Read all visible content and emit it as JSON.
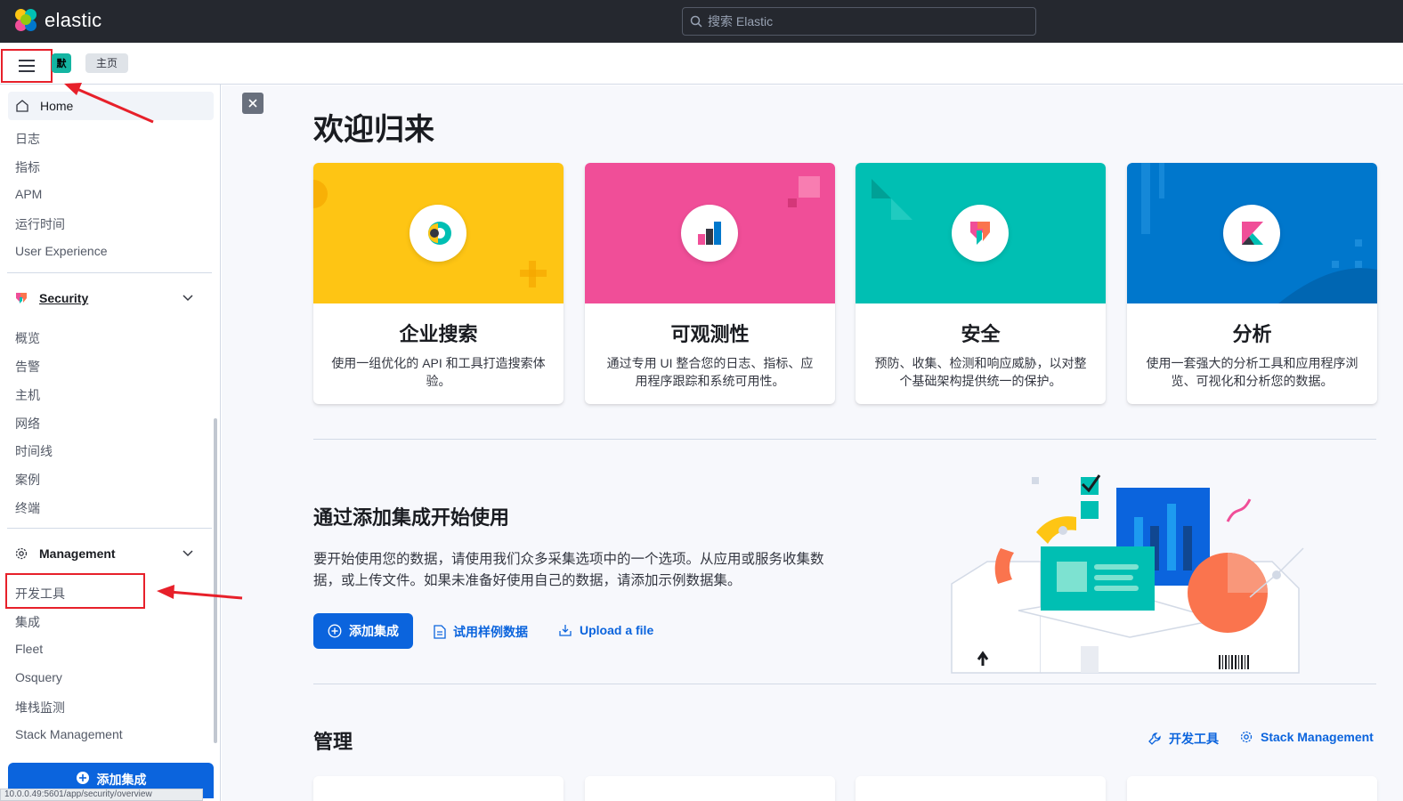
{
  "header": {
    "logo_text": "elastic",
    "search_placeholder": "搜索 Elastic"
  },
  "breadcrumb": {
    "space_initial": "默",
    "items": [
      "主页"
    ]
  },
  "sidenav": {
    "home_label": "Home",
    "observability_items": [
      "日志",
      "指标",
      "APM",
      "运行时间",
      "User Experience"
    ],
    "security": {
      "label": "Security",
      "items": [
        "概览",
        "告警",
        "主机",
        "网络",
        "时间线",
        "案例",
        "终端"
      ]
    },
    "management": {
      "label": "Management",
      "items": [
        "开发工具",
        "集成",
        "Fleet",
        "Osquery",
        "堆栈监测",
        "Stack Management"
      ]
    },
    "bottom_button": "添加集成",
    "status_url": "10.0.0.49:5601/app/security/overview"
  },
  "main": {
    "title": "欢迎归来",
    "cards": [
      {
        "title": "企业搜索",
        "desc": "使用一组优化的 API 和工具打造搜索体验。",
        "color": "#fec514"
      },
      {
        "title": "可观测性",
        "desc": "通过专用 UI 整合您的日志、指标、应用程序跟踪和系统可用性。",
        "color": "#f04e98"
      },
      {
        "title": "安全",
        "desc": "预防、收集、检测和响应威胁，以对整个基础架构提供统一的保护。",
        "color": "#00bfb3"
      },
      {
        "title": "分析",
        "desc": "使用一套强大的分析工具和应用程序浏览、可视化和分析您的数据。",
        "color": "#0077cc"
      }
    ],
    "ingest": {
      "title": "通过添加集成开始使用",
      "desc": "要开始使用您的数据，请使用我们众多采集选项中的一个选项。从应用或服务收集数据，或上传文件。如果未准备好使用自己的数据，请添加示例数据集。",
      "add_button": "添加集成",
      "sample_link": "试用样例数据",
      "upload_link": "Upload a file"
    },
    "management": {
      "title": "管理",
      "dev_tools_link": "开发工具",
      "stack_link": "Stack Management"
    }
  },
  "colors": {
    "accent": "#0b64dd",
    "header_bg": "#25282f",
    "annotation_red": "#e7202a"
  }
}
